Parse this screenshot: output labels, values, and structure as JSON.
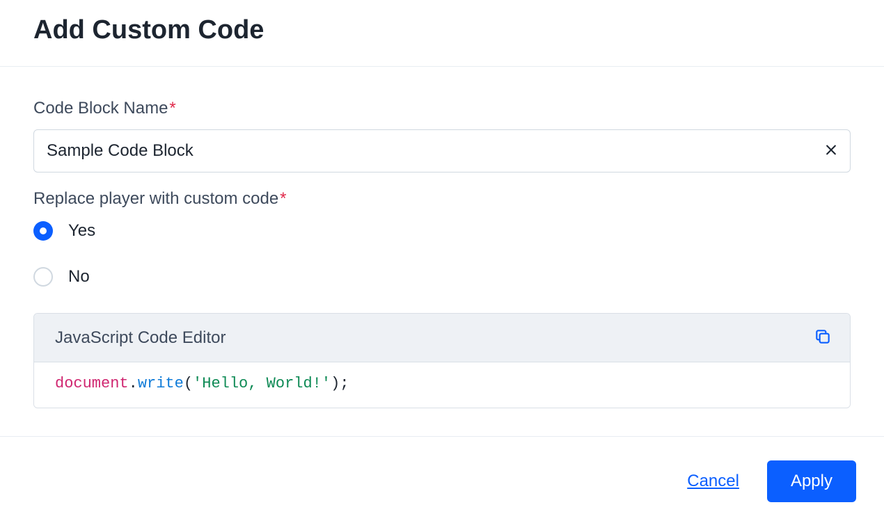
{
  "header": {
    "title": "Add Custom Code"
  },
  "form": {
    "nameLabel": "Code Block Name",
    "nameValue": "Sample Code Block",
    "replaceLabel": "Replace player with custom code",
    "options": {
      "yes": "Yes",
      "no": "No"
    },
    "selected": "yes"
  },
  "editor": {
    "title": "JavaScript Code Editor",
    "tokens": {
      "obj": "document",
      "dot": ".",
      "fn": "write",
      "openParen": "(",
      "str": "'Hello, World!'",
      "closeParen": ")",
      "semi": ";"
    }
  },
  "footer": {
    "cancel": "Cancel",
    "apply": "Apply"
  }
}
